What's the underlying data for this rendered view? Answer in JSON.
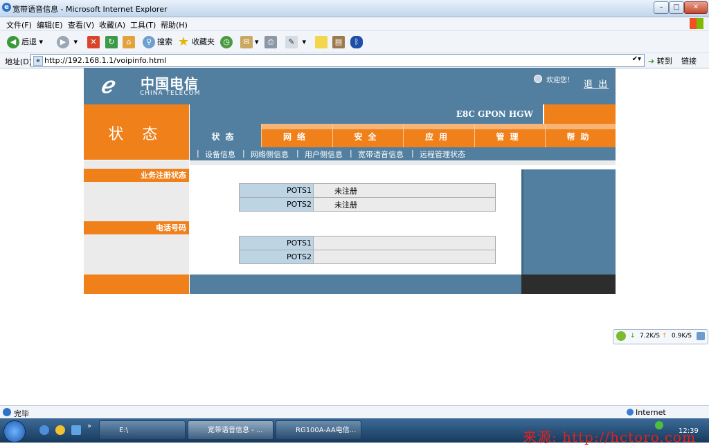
{
  "window": {
    "title": "宽带语音信息 - Microsoft Internet Explorer"
  },
  "menu": [
    "文件(F)",
    "编辑(E)",
    "查看(V)",
    "收藏(A)",
    "工具(T)",
    "帮助(H)"
  ],
  "toolbar": {
    "back": "后退",
    "search": "搜索",
    "favorites": "收藏夹"
  },
  "address": {
    "label": "地址(D)",
    "url": "http://192.168.1.1/voipinfo.html",
    "go": "转到",
    "links": "链接"
  },
  "header": {
    "brand_cn": "中国电信",
    "brand_en": "CHINA TELECOM",
    "welcome": "欢迎您！",
    "logout": "退 出",
    "model": "E8C GPON HGW",
    "section": "状 态"
  },
  "tabs": [
    "状态",
    "网络",
    "安全",
    "应用",
    "管理",
    "帮助"
  ],
  "active_tab": 0,
  "subnav": [
    "设备信息",
    "网络侧信息",
    "用户侧信息",
    "宽带语音信息",
    "远程管理状态"
  ],
  "sidebar": {
    "registration": "业务注册状态",
    "phone_number": "电话号码"
  },
  "registration_table": [
    {
      "port": "POTS1",
      "value": "未注册"
    },
    {
      "port": "POTS2",
      "value": "未注册"
    }
  ],
  "phone_table": [
    {
      "port": "POTS1",
      "value": ""
    },
    {
      "port": "POTS2",
      "value": ""
    }
  ],
  "speed": {
    "down": "7.2K/S",
    "up": "0.9K/S"
  },
  "statusbar": {
    "done": "完毕",
    "zone": "Internet"
  },
  "taskbar": {
    "items": [
      "E:\\",
      "宽带语音信息 - ...",
      "RG100A-AA电信..."
    ],
    "time": "12:39"
  },
  "watermark": "来源: http://hctoro.com",
  "colors": {
    "accent_orange": "#f0801a",
    "header_blue": "#527fa0"
  }
}
